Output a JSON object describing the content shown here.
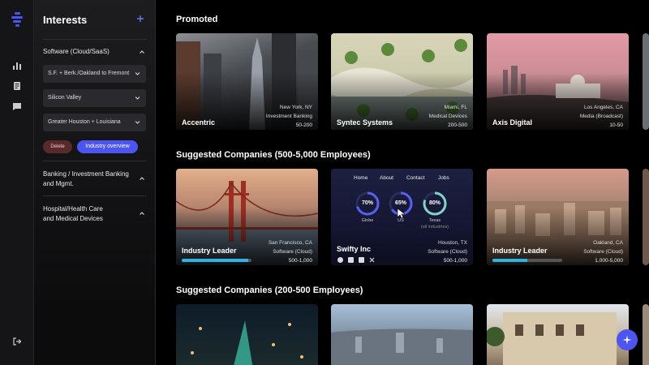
{
  "sidebar": {
    "title": "Interests",
    "sections": [
      {
        "label": "Software (Cloud/SaaS)",
        "filters": [
          "S.F. + Berk./Oakland to Fremont",
          "Silicon Valley",
          "Greater Houston + Louisiana"
        ],
        "delete_label": "Delete",
        "overview_label": "Industry overview"
      },
      {
        "label_line1": "Banking / Investment Banking",
        "label_line2": "and Mgmt."
      },
      {
        "label_line1": "Hospital/Health Care",
        "label_line2": "and Medical Devices"
      }
    ]
  },
  "main": {
    "promoted_title": "Promoted",
    "promoted": [
      {
        "name": "Accentric",
        "location": "New York, NY",
        "industry": "Investment Banking",
        "size": "50-200"
      },
      {
        "name": "Syntec Systems",
        "location": "Miami, FL",
        "industry": "Medical Devices",
        "size": "200-500"
      },
      {
        "name": "Axis Digital",
        "location": "Los Angeles, CA",
        "industry": "Media (Broadcast)",
        "size": "10-50"
      }
    ],
    "suggested_large_title": "Suggested Companies (500-5,000 Employees)",
    "suggested_large": [
      {
        "name": "Industry Leader",
        "location": "San Francisco, CA",
        "industry": "Software (Cloud)",
        "size": "500-1,000",
        "progress": 0.95
      },
      {
        "name": "Swifty Inc",
        "location": "Houston, TX",
        "industry": "Software (Cloud)",
        "size": "500-1,000",
        "nav": [
          "Home",
          "About",
          "Contact",
          "Jobs"
        ],
        "gauges": [
          {
            "value": "70%",
            "label": "Globe",
            "fraction": 0.7
          },
          {
            "value": "65%",
            "label": "US",
            "fraction": 0.65
          },
          {
            "value": "80%",
            "label": "Texas",
            "sublabel": "(all industries)",
            "fraction": 0.8
          }
        ]
      },
      {
        "name": "Industry Leader",
        "location": "Oakland, CA",
        "industry": "Software (Cloud)",
        "size": "1,000-5,000",
        "progress": 0.5
      }
    ],
    "suggested_mid_title": "Suggested Companies (200-500 Employees)"
  },
  "colors": {
    "accent": "#4d55f0",
    "progress": "#2bb3e6",
    "delete": "#5a2a2a"
  }
}
